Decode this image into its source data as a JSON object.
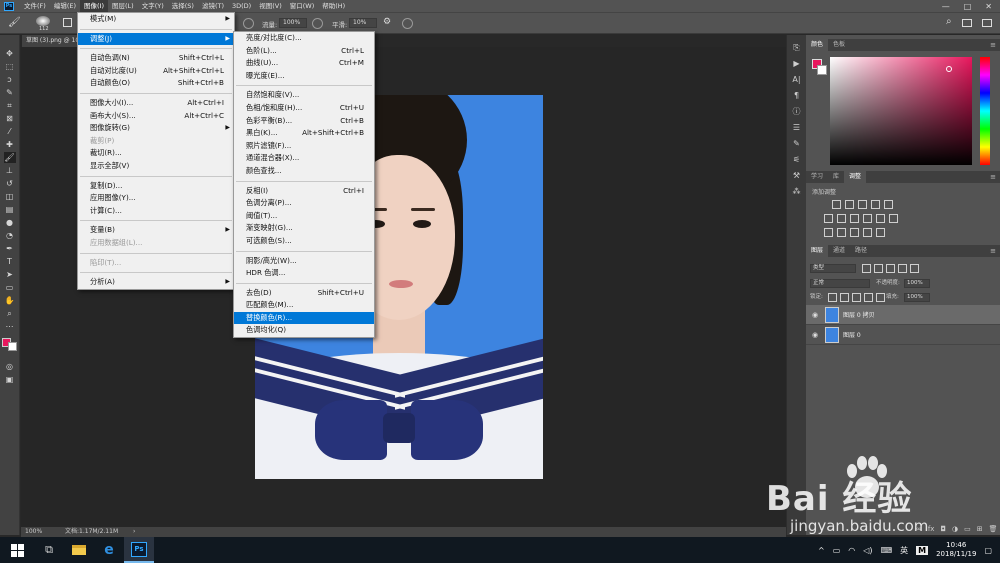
{
  "app": {
    "logo_text": "Ps",
    "doc_tab": "草图 (3).png @ 10",
    "status_zoom": "100%",
    "status_doc": "文档:1.17M/2.11M"
  },
  "menubar": {
    "items": [
      "文件(F)",
      "编辑(E)",
      "图像(I)",
      "图层(L)",
      "文字(Y)",
      "选择(S)",
      "滤镜(T)",
      "3D(D)",
      "视图(V)",
      "窗口(W)",
      "帮助(H)"
    ],
    "active_index": 2,
    "window_controls": [
      "—",
      "□",
      "✕"
    ]
  },
  "options_bar": {
    "brush_size": "112",
    "opacity_label": "流量:",
    "opacity_value": "100%",
    "smooth_label": "平滑:",
    "smooth_value": "10%"
  },
  "image_menu": {
    "items": [
      {
        "label": "模式(M)",
        "shortcut": "",
        "submenu": true,
        "disabled": false,
        "highlight": false
      },
      {
        "sep": true
      },
      {
        "label": "调整(J)",
        "shortcut": "",
        "submenu": true,
        "disabled": false,
        "highlight": true
      },
      {
        "sep": true
      },
      {
        "label": "自动色调(N)",
        "shortcut": "Shift+Ctrl+L",
        "submenu": false,
        "disabled": false,
        "highlight": false
      },
      {
        "label": "自动对比度(U)",
        "shortcut": "Alt+Shift+Ctrl+L",
        "submenu": false,
        "disabled": false,
        "highlight": false
      },
      {
        "label": "自动颜色(O)",
        "shortcut": "Shift+Ctrl+B",
        "submenu": false,
        "disabled": false,
        "highlight": false
      },
      {
        "sep": true
      },
      {
        "label": "图像大小(I)...",
        "shortcut": "Alt+Ctrl+I",
        "submenu": false,
        "disabled": false,
        "highlight": false
      },
      {
        "label": "画布大小(S)...",
        "shortcut": "Alt+Ctrl+C",
        "submenu": false,
        "disabled": false,
        "highlight": false
      },
      {
        "label": "图像旋转(G)",
        "shortcut": "",
        "submenu": true,
        "disabled": false,
        "highlight": false
      },
      {
        "label": "裁剪(P)",
        "shortcut": "",
        "submenu": false,
        "disabled": true,
        "highlight": false
      },
      {
        "label": "裁切(R)...",
        "shortcut": "",
        "submenu": false,
        "disabled": false,
        "highlight": false
      },
      {
        "label": "显示全部(V)",
        "shortcut": "",
        "submenu": false,
        "disabled": false,
        "highlight": false
      },
      {
        "sep": true
      },
      {
        "label": "复制(D)...",
        "shortcut": "",
        "submenu": false,
        "disabled": false,
        "highlight": false
      },
      {
        "label": "应用图像(Y)...",
        "shortcut": "",
        "submenu": false,
        "disabled": false,
        "highlight": false
      },
      {
        "label": "计算(C)...",
        "shortcut": "",
        "submenu": false,
        "disabled": false,
        "highlight": false
      },
      {
        "sep": true
      },
      {
        "label": "变量(B)",
        "shortcut": "",
        "submenu": true,
        "disabled": false,
        "highlight": false
      },
      {
        "label": "应用数据组(L)...",
        "shortcut": "",
        "submenu": false,
        "disabled": true,
        "highlight": false
      },
      {
        "sep": true
      },
      {
        "label": "陷印(T)...",
        "shortcut": "",
        "submenu": false,
        "disabled": true,
        "highlight": false
      },
      {
        "sep": true
      },
      {
        "label": "分析(A)",
        "shortcut": "",
        "submenu": true,
        "disabled": false,
        "highlight": false
      }
    ]
  },
  "adjust_menu": {
    "items": [
      {
        "label": "亮度/对比度(C)...",
        "shortcut": "",
        "highlight": false
      },
      {
        "label": "色阶(L)...",
        "shortcut": "Ctrl+L",
        "highlight": false
      },
      {
        "label": "曲线(U)...",
        "shortcut": "Ctrl+M",
        "highlight": false
      },
      {
        "label": "曝光度(E)...",
        "shortcut": "",
        "highlight": false
      },
      {
        "sep": true
      },
      {
        "label": "自然饱和度(V)...",
        "shortcut": "",
        "highlight": false
      },
      {
        "label": "色相/饱和度(H)...",
        "shortcut": "Ctrl+U",
        "highlight": false
      },
      {
        "label": "色彩平衡(B)...",
        "shortcut": "Ctrl+B",
        "highlight": false
      },
      {
        "label": "黑白(K)...",
        "shortcut": "Alt+Shift+Ctrl+B",
        "highlight": false
      },
      {
        "label": "照片滤镜(F)...",
        "shortcut": "",
        "highlight": false
      },
      {
        "label": "通道混合器(X)...",
        "shortcut": "",
        "highlight": false
      },
      {
        "label": "颜色查找...",
        "shortcut": "",
        "highlight": false
      },
      {
        "sep": true
      },
      {
        "label": "反相(I)",
        "shortcut": "Ctrl+I",
        "highlight": false
      },
      {
        "label": "色调分离(P)...",
        "shortcut": "",
        "highlight": false
      },
      {
        "label": "阈值(T)...",
        "shortcut": "",
        "highlight": false
      },
      {
        "label": "渐变映射(G)...",
        "shortcut": "",
        "highlight": false
      },
      {
        "label": "可选颜色(S)...",
        "shortcut": "",
        "highlight": false
      },
      {
        "sep": true
      },
      {
        "label": "阴影/高光(W)...",
        "shortcut": "",
        "highlight": false
      },
      {
        "label": "HDR 色调...",
        "shortcut": "",
        "highlight": false
      },
      {
        "sep": true
      },
      {
        "label": "去色(D)",
        "shortcut": "Shift+Ctrl+U",
        "highlight": false
      },
      {
        "label": "匹配颜色(M)...",
        "shortcut": "",
        "highlight": false
      },
      {
        "label": "替换颜色(R)...",
        "shortcut": "",
        "highlight": true
      },
      {
        "label": "色调均化(Q)",
        "shortcut": "",
        "highlight": false
      }
    ]
  },
  "panels": {
    "color_tabs": [
      "颜色",
      "色板"
    ],
    "mid_tabs": [
      "学习",
      "库",
      "调整"
    ],
    "adjust_hint": "添加调整",
    "layer_tabs": [
      "图层",
      "通道",
      "路径"
    ],
    "filter_kind": "类型",
    "blend_mode": "正常",
    "opacity_label": "不透明度:",
    "opacity_value": "100%",
    "lock_label": "锁定:",
    "fill_label": "填充:",
    "fill_value": "100%",
    "layers": [
      {
        "name": "图层 0 拷贝",
        "selected": true
      },
      {
        "name": "图层 0",
        "selected": false
      }
    ]
  },
  "taskbar": {
    "ime": "英",
    "time": "10:46",
    "date": "2018/11/19"
  },
  "watermark": {
    "main": "Bai  经验",
    "sub": "jingyan.baidu.com"
  },
  "colors": {
    "foreground": "#e8175d",
    "accent": "#0078d7",
    "ps_blue": "#31a8ff"
  }
}
